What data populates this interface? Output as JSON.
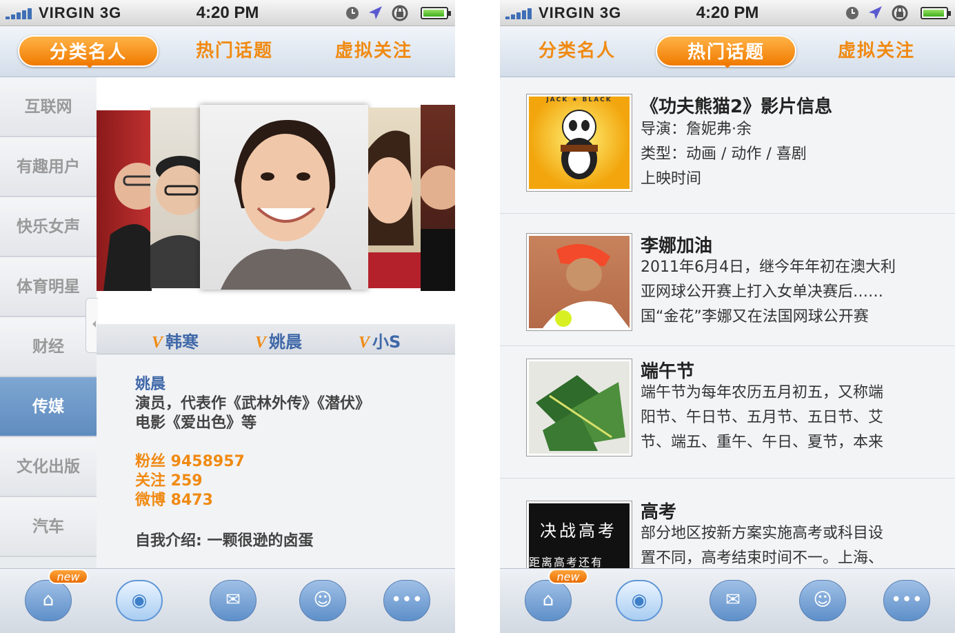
{
  "status": {
    "carrier": "VIRGIN 3G",
    "time": "4:20 PM"
  },
  "tabs": [
    "分类名人",
    "热门话题",
    "虚拟关注"
  ],
  "screen1": {
    "categories": [
      "互联网",
      "有趣用户",
      "快乐女声",
      "体育明星",
      "财经",
      "传媒",
      "文化出版",
      "汽车"
    ],
    "active_category": "传媒",
    "carousel_names": [
      "韩寒",
      "姚晨",
      "小S"
    ],
    "profile": {
      "name": "姚晨",
      "desc_line1": "演员，代表作《武林外传》《潜伏》",
      "desc_line2": "电影《爱出色》等",
      "fans": "粉丝  9458957",
      "follow": "关注  259",
      "weibo": "微博  8473",
      "intro": "自我介绍: 一颗很逊的卤蛋"
    }
  },
  "screen2": {
    "items": [
      {
        "title": "《功夫熊猫2》影片信息",
        "lines": [
          "导演：詹妮弗·余",
          "类型：动画 / 动作 / 喜剧",
          "上映时间"
        ],
        "thumb_text": "JACK ★ BLACK"
      },
      {
        "title": "李娜加油",
        "lines": [
          "2011年6月4日，继今年年初在澳大利",
          "亚网球公开赛上打入女单决赛后……",
          "国“金花”李娜又在法国网球公开赛"
        ]
      },
      {
        "title": "端午节",
        "lines": [
          "端午节为每年农历五月初五，又称端",
          "阳节、午日节、五月节、五日节、艾",
          "节、端五、重午、午日、夏节，本来"
        ]
      },
      {
        "title": "高考",
        "lines": [
          "部分地区按新方案实施高考或科目设",
          "置不同，高考结束时间不一。上海、"
        ],
        "thumb_text_1": "决战高考",
        "thumb_text_2": "距离高考还有"
      }
    ]
  },
  "bottom_bar": {
    "badge": "new",
    "icons": [
      "home-icon",
      "eye-icon",
      "mail-icon",
      "contact-icon",
      "more-icon"
    ]
  },
  "colors": {
    "accent_orange": "#f08a12",
    "nav_blue": "#5f8cbf",
    "name_blue": "#3f68a8"
  }
}
